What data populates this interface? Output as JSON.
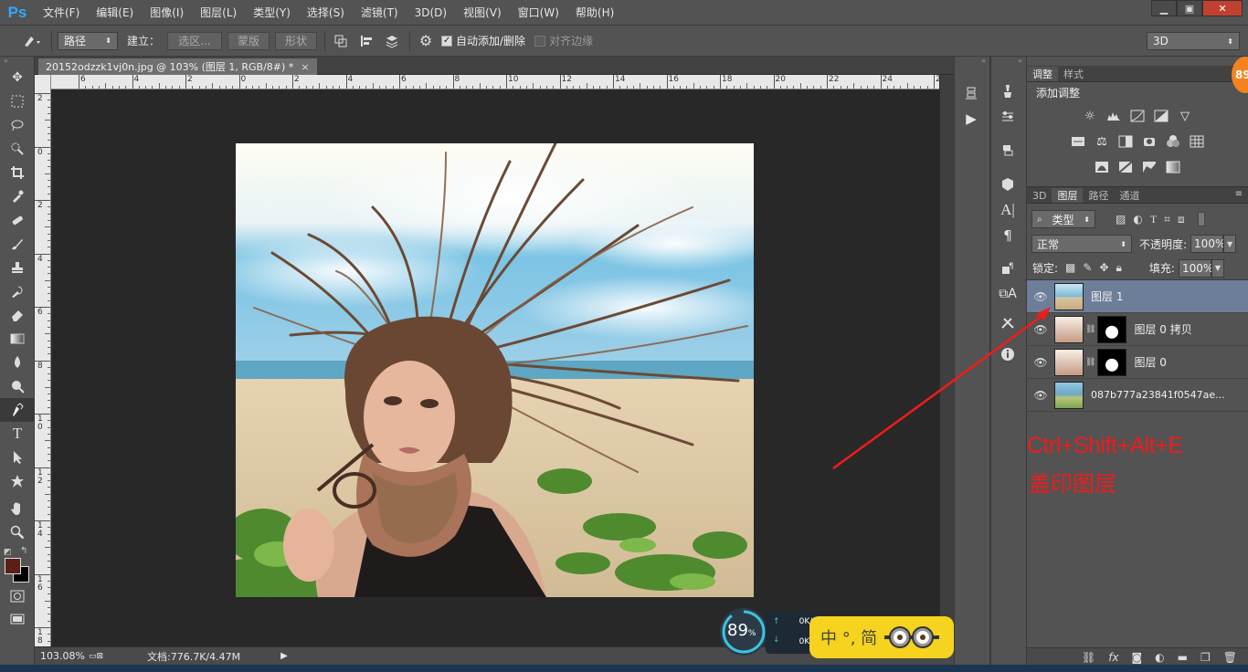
{
  "app": {
    "logo": "Ps"
  },
  "menu": [
    "文件(F)",
    "编辑(E)",
    "图像(I)",
    "图层(L)",
    "类型(Y)",
    "选择(S)",
    "滤镜(T)",
    "3D(D)",
    "视图(V)",
    "窗口(W)",
    "帮助(H)"
  ],
  "window_controls": {
    "minimize": "▁",
    "restore": "▣",
    "close": "✕"
  },
  "options": {
    "mode": "路径",
    "make_label": "建立：",
    "selection_btn": "选区...",
    "mask_btn": "蒙版",
    "shape_btn": "形状",
    "auto_add_delete": "自动添加/删除",
    "auto_add_checked": true,
    "align_edges": "对齐边缘",
    "align_checked": false,
    "workspace": "3D"
  },
  "document": {
    "tab_title": "20152odzzk1vj0n.jpg @ 103% (图层 1, RGB/8#) *",
    "tab_close": "×",
    "zoom": "103.08%",
    "doc_info": "文档:776.7K/4.47M"
  },
  "ruler": {
    "h_labels": [
      "6",
      "4",
      "2",
      "0",
      "2",
      "4",
      "6",
      "8",
      "10",
      "12",
      "14",
      "16",
      "18",
      "20",
      "22",
      "24",
      "2"
    ],
    "v_labels": [
      "2",
      "0",
      "2",
      "4",
      "6",
      "8",
      "1\n0",
      "1\n2",
      "1\n4",
      "1\n6",
      "1\n8"
    ]
  },
  "adjustments": {
    "tabs": [
      "调整",
      "样式"
    ],
    "title": "添加调整",
    "icon_names": [
      [
        "brightness-icon",
        "levels-icon",
        "curves-icon",
        "exposure-icon",
        "vibrance-icon"
      ],
      [
        "hue-sat-icon",
        "color-balance-icon",
        "bw-icon",
        "photo-filter-icon",
        "channel-mixer-icon",
        "color-lookup-icon"
      ],
      [
        "invert-icon",
        "posterize-icon",
        "threshold-icon",
        "gradient-map-icon"
      ]
    ]
  },
  "layers_panel": {
    "tabs": [
      "3D",
      "图层",
      "路径",
      "通道"
    ],
    "active_tab": "图层",
    "filter_kind": "类型",
    "blend_mode": "正常",
    "opacity_label": "不透明度:",
    "opacity": "100%",
    "lock_label": "锁定:",
    "fill_label": "填充:",
    "fill": "100%",
    "layers": [
      {
        "name": "图层 1",
        "selected": true,
        "mask": false
      },
      {
        "name": "图层 0 拷贝",
        "selected": false,
        "mask": true
      },
      {
        "name": "图层 0",
        "selected": false,
        "mask": true
      },
      {
        "name": "087b777a23841f0547ae...",
        "selected": false,
        "mask": false
      }
    ]
  },
  "annotation": {
    "shortcut": "Ctrl+Shift+Alt+E",
    "caption": "盖印图层",
    "color": "#f21b1b"
  },
  "net_widget": {
    "cpu": "89",
    "cpu_unit": "%",
    "up": "0K/s",
    "down": "0K/s"
  },
  "ime": {
    "text": "中 °, 简"
  },
  "corner_badge": "89"
}
